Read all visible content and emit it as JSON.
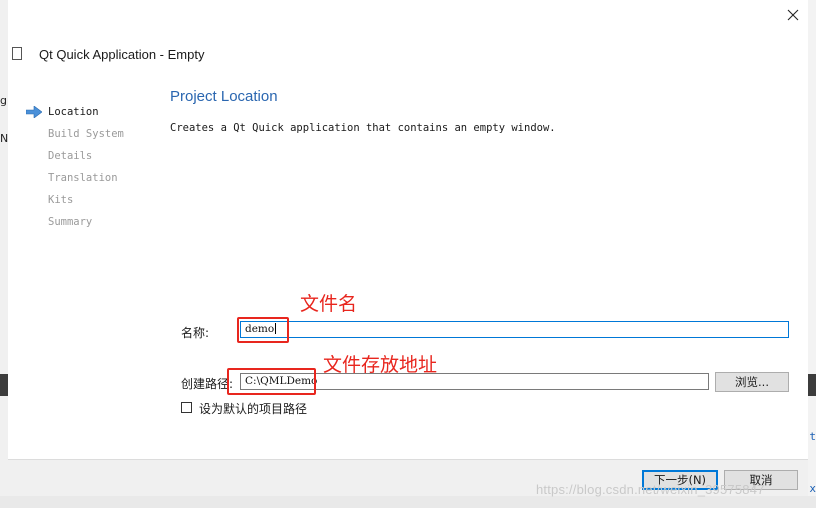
{
  "window": {
    "title": "Qt Quick Application - Empty"
  },
  "background": {
    "left_chars": [
      "g",
      "N"
    ],
    "right_chars": [
      "t",
      "x"
    ],
    "watermark": "https://blog.csdn.net/weixin_39575847"
  },
  "wizard": {
    "steps": [
      {
        "label": "Location",
        "active": true
      },
      {
        "label": "Build System",
        "active": false
      },
      {
        "label": "Details",
        "active": false
      },
      {
        "label": "Translation",
        "active": false
      },
      {
        "label": "Kits",
        "active": false
      },
      {
        "label": "Summary",
        "active": false
      }
    ]
  },
  "page": {
    "title": "Project Location",
    "description": "Creates a Qt Quick application that contains an empty window."
  },
  "form": {
    "name_label": "名称:",
    "name_value": "demo",
    "path_label": "创建路径:",
    "path_value": "C:\\QMLDemo",
    "browse_label": "浏览...",
    "default_checkbox_label": "设为默认的项目路径",
    "default_checked": false
  },
  "footer": {
    "next_label": "下一步(N)",
    "cancel_label": "取消"
  },
  "annotations": {
    "name_note": "文件名",
    "path_note": "文件存放地址"
  },
  "colors": {
    "annotation": "#e8261e",
    "accent": "#0078d7",
    "title_blue": "#2a66b0"
  }
}
